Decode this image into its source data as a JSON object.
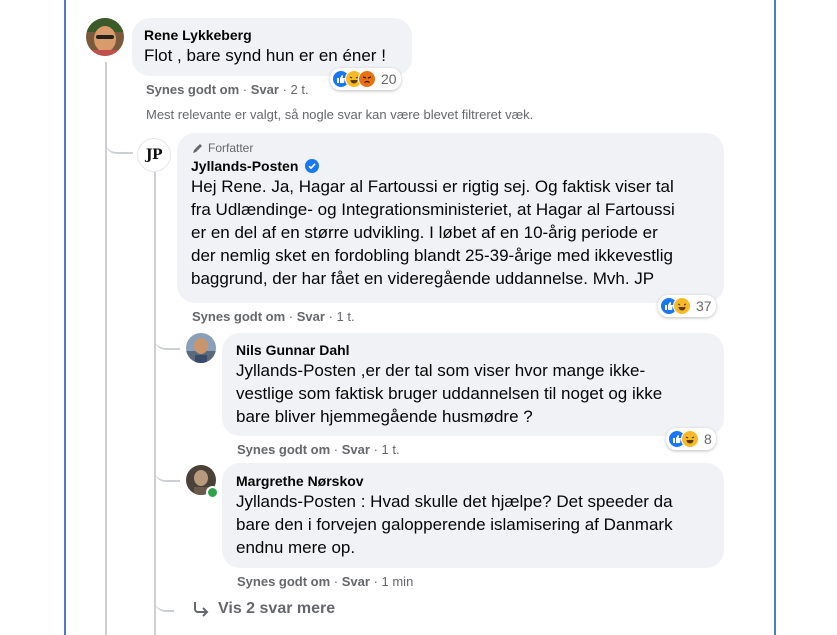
{
  "comment_main": {
    "author": "Rene Lykkeberg",
    "text": "Flot , bare synd hun er en éner !",
    "like_label": "Synes godt om",
    "reply_label": "Svar",
    "time": "2 t.",
    "reaction_count": "20"
  },
  "filter_note": "Mest relevante er valgt, så nogle svar kan være blevet filtreret væk.",
  "reply_jp": {
    "badge": "Forfatter",
    "author": "Jyllands-Posten",
    "avatar_text": "JP",
    "lines": [
      "Hej Rene. Ja, Hagar al Fartoussi er rigtig sej. Og faktisk viser tal",
      "fra Udlændinge- og Integrationsministeriet, at Hagar al Fartoussi",
      "er en del af en større udvikling. I løbet af en 10-årig periode er",
      "der nemlig sket en fordobling blandt 25-39-årige med ikkevestlig",
      "baggrund, der har fået en videregående uddannelse. Mvh. JP"
    ],
    "like_label": "Synes godt om",
    "reply_label": "Svar",
    "time": "1 t.",
    "reaction_count": "37"
  },
  "reply_nils": {
    "author": "Nils Gunnar Dahl",
    "mention": "Jyllands-Posten",
    "line1_rest": " ,er der tal som viser hvor mange ikke-",
    "line2": "vestlige som faktisk bruger uddannelsen til noget og ikke",
    "line3": "bare bliver hjemmegående husmødre ?",
    "like_label": "Synes godt om",
    "reply_label": "Svar",
    "time": "1 t.",
    "reaction_count": "8"
  },
  "reply_margrethe": {
    "author": "Margrethe Nørskov",
    "mention": "Jyllands-Posten",
    "line1_rest": " : Hvad skulle det hjælpe? Det speeder da",
    "line2": "bare den i forvejen galopperende islamisering af Danmark",
    "line3": "endnu mere op.",
    "like_label": "Synes godt om",
    "reply_label": "Svar",
    "time": "1 min"
  },
  "more_replies": "Vis 2 svar mere",
  "colors": {
    "accent": "#1877f2",
    "bubble": "#f0f2f5",
    "meta": "#65676b",
    "frame": "#4a7cc7"
  },
  "icons": [
    "like-reaction-icon",
    "haha-reaction-icon",
    "angry-reaction-icon",
    "pencil-icon",
    "verified-icon",
    "reply-arrow-icon"
  ]
}
